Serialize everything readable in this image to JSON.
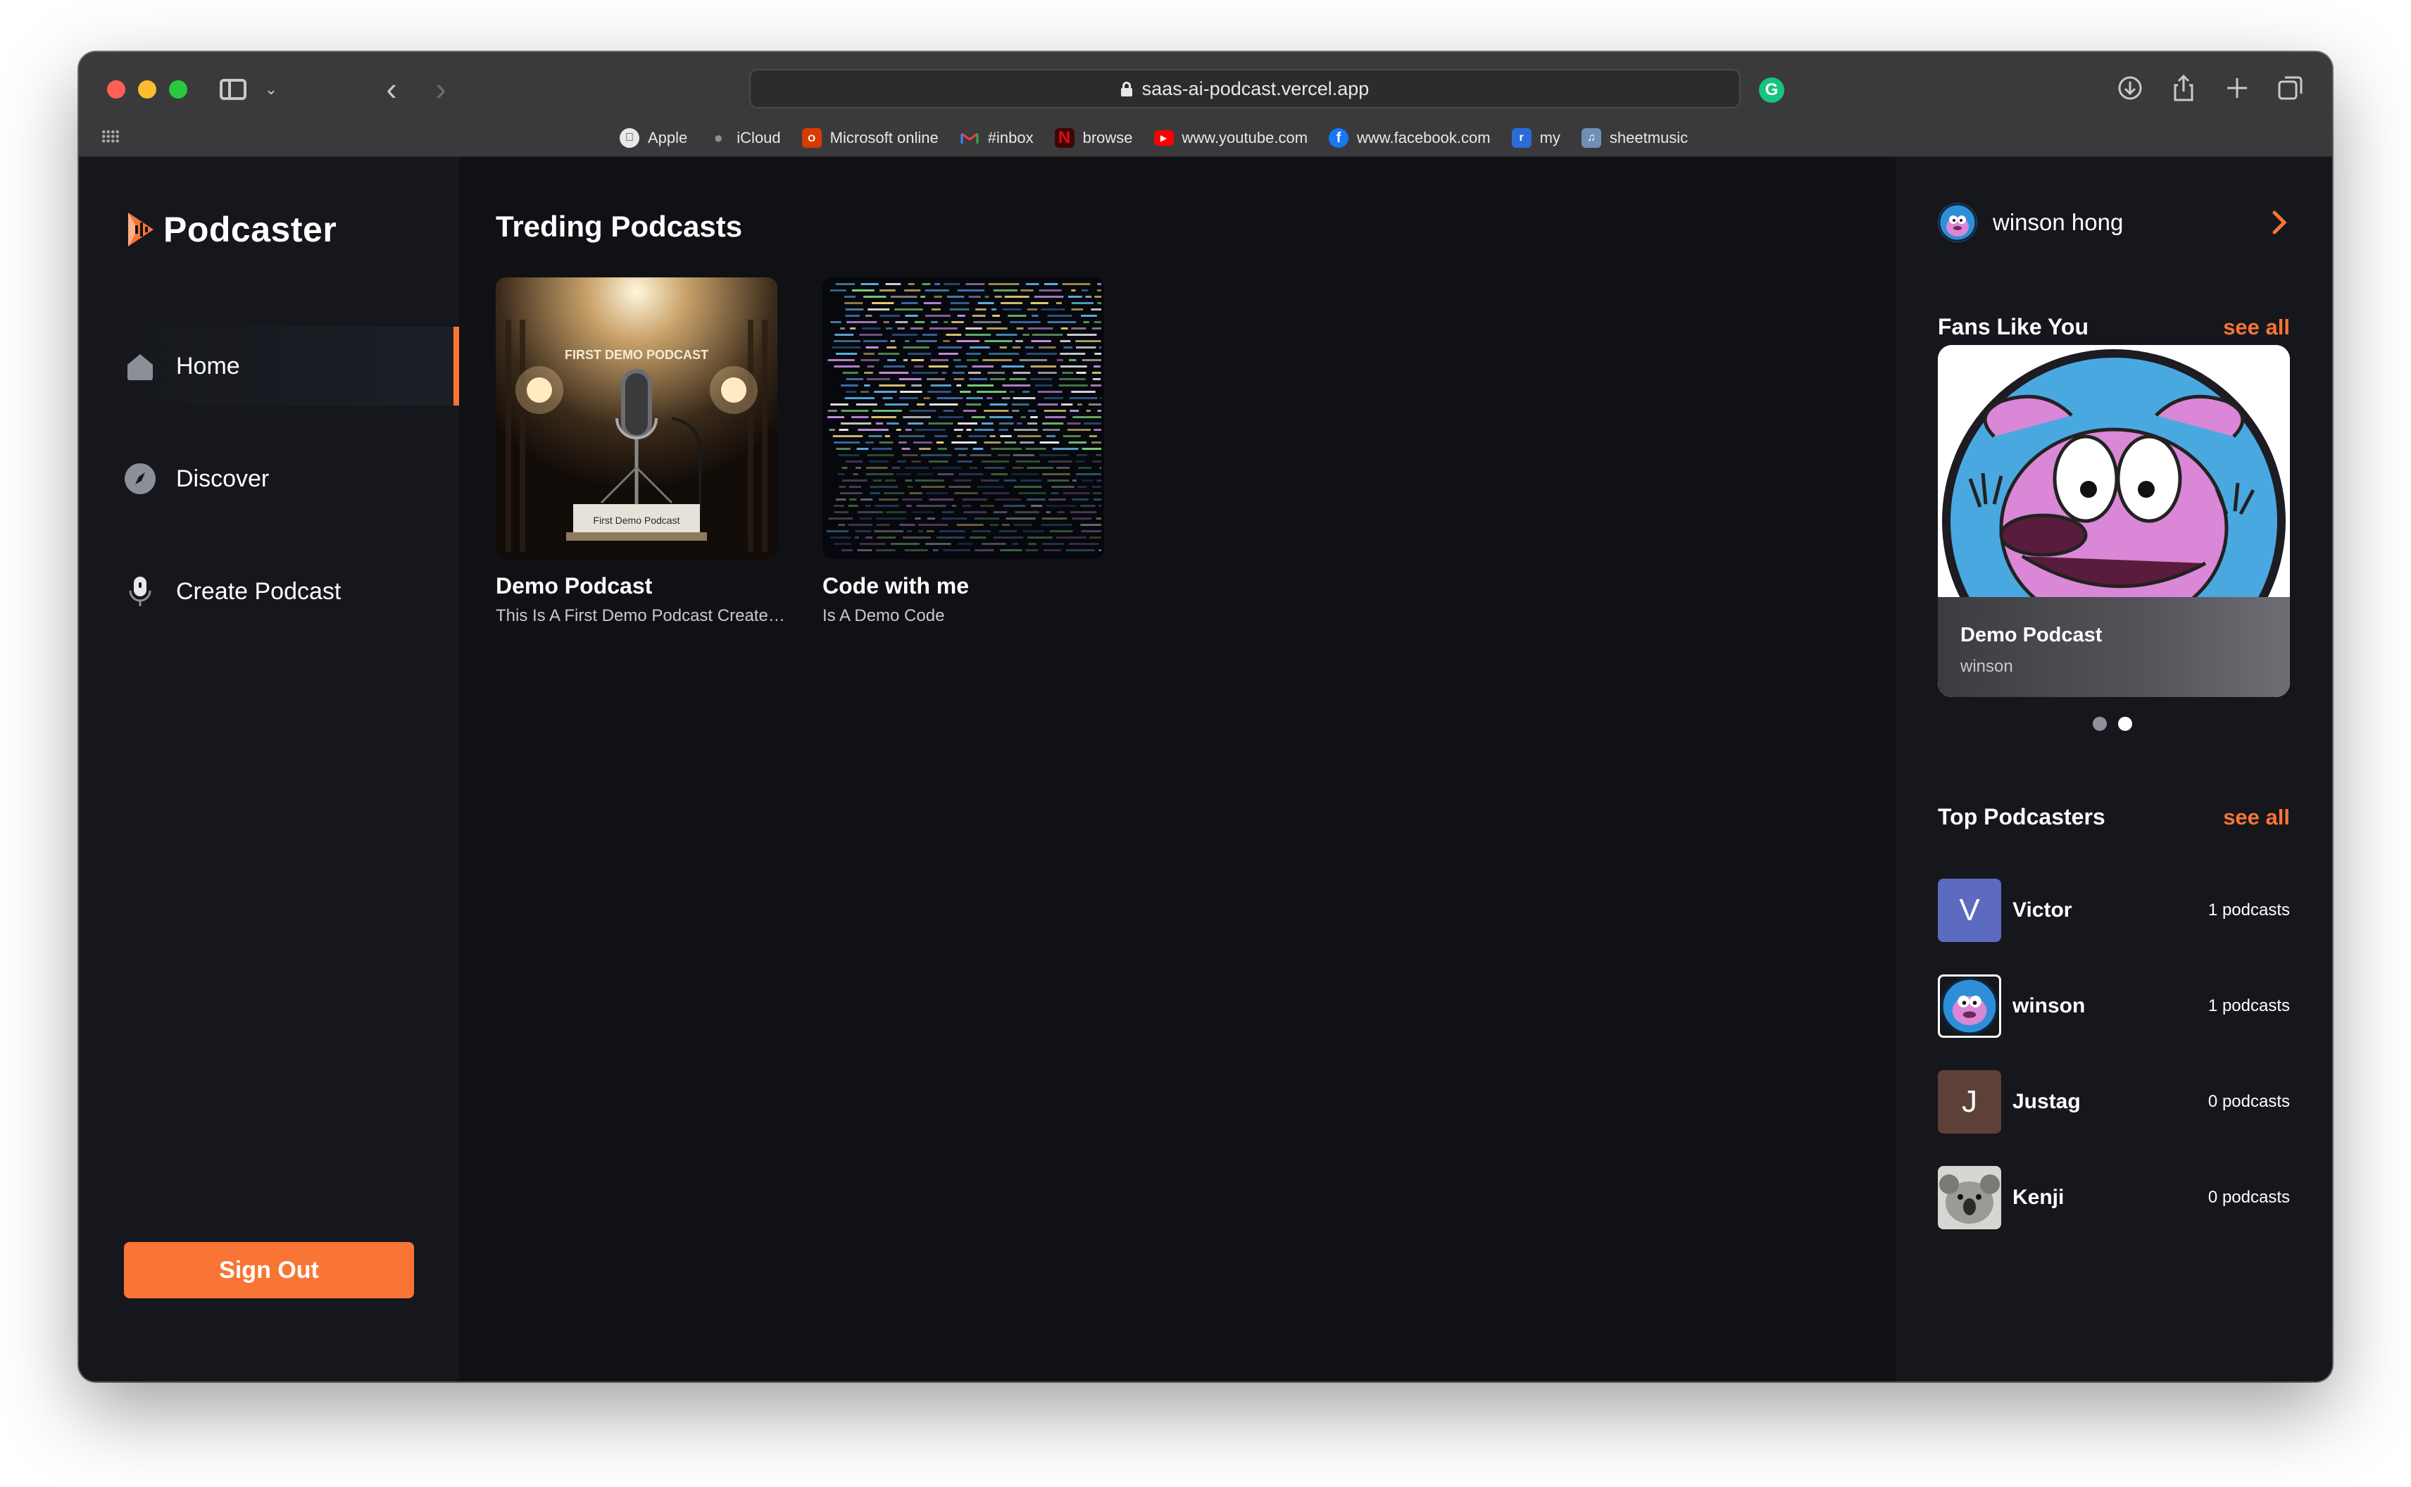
{
  "browser": {
    "url": "saas-ai-podcast.vercel.app",
    "bookmarks": [
      {
        "label": "Apple",
        "icon": "apple-icon",
        "color": "#e8e8ea"
      },
      {
        "label": "iCloud",
        "icon": "apple-icon",
        "color": "#8e8e93"
      },
      {
        "label": "Microsoft online",
        "icon": "office-icon",
        "color": "#d83b01"
      },
      {
        "label": "#inbox",
        "icon": "gmail-icon",
        "color": "#ea4335"
      },
      {
        "label": "browse",
        "icon": "netflix-icon",
        "color": "#e50914"
      },
      {
        "label": "www.youtube.com",
        "icon": "youtube-icon",
        "color": "#ff0000"
      },
      {
        "label": "www.facebook.com",
        "icon": "facebook-icon",
        "color": "#1877f2"
      },
      {
        "label": "my",
        "icon": "bookmark-icon",
        "color": "#2a6bd4"
      },
      {
        "label": "sheetmusic",
        "icon": "sheetmusic-icon",
        "color": "#6f8fb3"
      }
    ]
  },
  "sidebar": {
    "brand": "Podcaster",
    "nav": [
      {
        "label": "Home",
        "icon": "home-icon",
        "active": true
      },
      {
        "label": "Discover",
        "icon": "compass-icon",
        "active": false
      },
      {
        "label": "Create Podcast",
        "icon": "microphone-icon",
        "active": false
      }
    ],
    "signout_label": "Sign Out"
  },
  "main": {
    "title": "Treding Podcasts",
    "podcasts": [
      {
        "title": "Demo Podcast",
        "description": "This Is A First Demo Podcast Created ...",
        "image": "microphone-stage-image",
        "image_text_top": "FIRST DEMO PODCAST",
        "image_text_plaque": "First Demo Podcast"
      },
      {
        "title": "Code with me",
        "description": "Is A Demo Code",
        "image": "code-screen-image"
      }
    ]
  },
  "right": {
    "user_name": "winson hong",
    "fans": {
      "title": "Fans Like You",
      "see_all": "see all",
      "featured": {
        "title": "Demo Podcast",
        "author": "winson"
      },
      "dots": [
        false,
        true
      ]
    },
    "top": {
      "title": "Top Podcasters",
      "see_all": "see all",
      "list": [
        {
          "name": "Victor",
          "count": "1 podcasts",
          "initial": "V",
          "avatar_color": "#5c6bc0"
        },
        {
          "name": "winson",
          "count": "1 podcasts",
          "initial": "",
          "avatar_color": "#2e8fd8"
        },
        {
          "name": "Justag",
          "count": "0 podcasts",
          "initial": "J",
          "avatar_color": "#5d4037"
        },
        {
          "name": "Kenji",
          "count": "0 podcasts",
          "initial": "",
          "avatar_color": "#8a8a88"
        }
      ]
    }
  },
  "colors": {
    "accent": "#f97535",
    "background": "#101114",
    "panel": "#15171c"
  }
}
